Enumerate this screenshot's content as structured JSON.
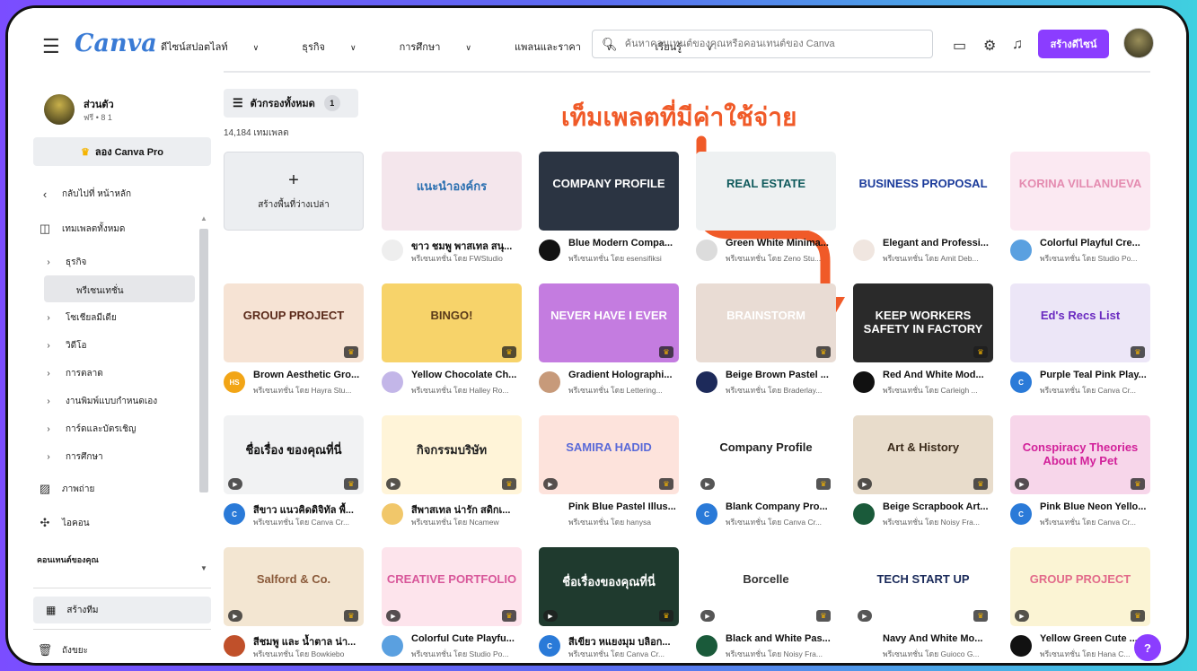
{
  "nav": {
    "logo": "Canva",
    "menu": [
      "ดีไซน์สปอตไลท์",
      "ธุรกิจ",
      "การศึกษา",
      "แพลนและราคา",
      "เรียนรู้"
    ],
    "search_placeholder": "ค้นหาคอนเทนต์ของคุณหรือคอนเทนต์ของ Canva",
    "create_label": "สร้างดีไซน์"
  },
  "sidebar": {
    "account_name": "ส่วนตัว",
    "account_sub": "ฟรี • 8 1",
    "try_pro": "ลอง Canva Pro",
    "back": "กลับไปที่ หน้าหลัก",
    "all_templates": "เทมเพลตทั้งหมด",
    "business": "ธุรกิจ",
    "presentation": "พรีเซนเทชั่น",
    "social": "โซเชียลมีเดีย",
    "video": "วิดีโอ",
    "marketing": "การตลาด",
    "custom_print": "งานพิมพ์แบบกำหนดเอง",
    "cards": "การ์ดและบัตรเชิญ",
    "education": "การศึกษา",
    "photos": "ภาพถ่าย",
    "icons": "ไอคอน",
    "your_content": "คอนเทนต์ของคุณ",
    "create_team": "สร้างทีม",
    "trash": "ถังขยะ"
  },
  "main": {
    "filter_label": "ตัวกรองทั้งหมด",
    "filter_count": "1",
    "template_count": "14,184 เทมเพลต",
    "headline": "เท็มเพลตที่มีค่าใช้จ่าย",
    "blank_label": "สร้างพื้นที่ว่างเปล่า"
  },
  "cards": [
    {
      "title": "ขาว ชมพู พาสเทล สนุ...",
      "by": "พรีเซนเทชั่น โดย FWStudio",
      "thumb_text": "แนะนำองค์กร",
      "bg": "#f4e6ec",
      "fg": "#2a6fb0",
      "avatar": "",
      "avatar_bg": "#eeeeee"
    },
    {
      "title": "Blue Modern Compa...",
      "by": "พรีเซนเทชั่น โดย esensifiksi",
      "thumb_text": "COMPANY PROFILE",
      "bg": "#2b3442",
      "fg": "#ffffff",
      "avatar": "",
      "avatar_bg": "#111111"
    },
    {
      "title": "Green White Minima...",
      "by": "พรีเซนเทชั่น โดย Zeno Stu...",
      "thumb_text": "REAL ESTATE",
      "bg": "#eef1f2",
      "fg": "#0f5a5c",
      "avatar": "",
      "avatar_bg": "#dcdcdc"
    },
    {
      "title": "Elegant and Professi...",
      "by": "พรีเซนเทชั่น โดย Amit Deb...",
      "thumb_text": "BUSINESS PROPOSAL",
      "bg": "#ffffff",
      "fg": "#1a3a9a",
      "avatar": "",
      "avatar_bg": "#f0e6e0"
    },
    {
      "title": "Colorful Playful Cre...",
      "by": "พรีเซนเทชั่น โดย Studio Po...",
      "thumb_text": "KORINA VILLANUEVA",
      "bg": "#fbe9f2",
      "fg": "#e48bb0",
      "avatar": "",
      "avatar_bg": "#5aa0e0"
    },
    {
      "title": "Brown Aesthetic Gro...",
      "by": "พรีเซนเทชั่น โดย Hayra Stu...",
      "thumb_text": "GROUP PROJECT",
      "bg": "#f6e3d4",
      "fg": "#5a2a1a",
      "avatar": "HS",
      "avatar_bg": "#f2a516"
    },
    {
      "title": "Yellow Chocolate Ch...",
      "by": "พรีเซนเทชั่น โดย Halley Ro...",
      "thumb_text": "BINGO!",
      "bg": "#f7d36a",
      "fg": "#5a3a1a",
      "avatar": "",
      "avatar_bg": "#c3b6e8"
    },
    {
      "title": "Gradient Holographi...",
      "by": "พรีเซนเทชั่น โดย Lettering...",
      "thumb_text": "NEVER HAVE I EVER",
      "bg": "#c47ce0",
      "fg": "#ffffff",
      "avatar": "",
      "avatar_bg": "#c79a7a"
    },
    {
      "title": "Beige Brown Pastel ...",
      "by": "พรีเซนเทชั่น โดย Braderlay...",
      "thumb_text": "BRAINSTORM",
      "bg": "#e9dcd4",
      "fg": "#ffffff",
      "avatar": "",
      "avatar_bg": "#1d2a5a"
    },
    {
      "title": "Red And White Mod...",
      "by": "พรีเซนเทชั่น โดย Carleigh ...",
      "thumb_text": "KEEP WORKERS SAFETY IN FACTORY",
      "bg": "#2a2a2a",
      "fg": "#ffffff",
      "avatar": "",
      "avatar_bg": "#111111"
    },
    {
      "title": "Purple Teal Pink Play...",
      "by": "พรีเซนเทชั่น โดย Canva Cr...",
      "thumb_text": "Ed's Recs List",
      "bg": "#ece6f7",
      "fg": "#6a2ac0",
      "avatar": "C",
      "avatar_bg": "#2a7ad8"
    },
    {
      "title": "สีขาว แนวคิดดิจิทัล พื้...",
      "by": "พรีเซนเทชั่น โดย Canva Cr...",
      "thumb_text": "ชื่อเรื่อง ของคุณที่นี่",
      "bg": "#f1f2f3",
      "fg": "#111111",
      "avatar": "C",
      "avatar_bg": "#2a7ad8"
    },
    {
      "title": "สีพาสเทล น่ารัก สดิกเ...",
      "by": "พรีเซนเทชั่น โดย Ncamew",
      "thumb_text": "กิจกรรมบริษัท",
      "bg": "#fff4d8",
      "fg": "#222222",
      "avatar": "",
      "avatar_bg": "#f1c76a"
    },
    {
      "title": "Pink Blue Pastel Illus...",
      "by": "พรีเซนเทชั่น โดย hanysa",
      "thumb_text": "SAMIRA HADID",
      "bg": "#fde3dc",
      "fg": "#5a6ad8",
      "avatar": "",
      "avatar_bg": "#ffffff"
    },
    {
      "title": "Blank Company Pro...",
      "by": "พรีเซนเทชั่น โดย Canva Cr...",
      "thumb_text": "Company Profile",
      "bg": "#ffffff",
      "fg": "#222222",
      "avatar": "C",
      "avatar_bg": "#2a7ad8"
    },
    {
      "title": "Beige Scrapbook Art...",
      "by": "พรีเซนเทชั่น โดย Noisy Fra...",
      "thumb_text": "Art & History",
      "bg": "#e8dccb",
      "fg": "#3a2a1a",
      "avatar": "",
      "avatar_bg": "#1a5a3a"
    },
    {
      "title": "Pink Blue Neon Yello...",
      "by": "พรีเซนเทชั่น โดย Canva Cr...",
      "thumb_text": "Conspiracy Theories About My Pet",
      "bg": "#f7d6ea",
      "fg": "#d2219a",
      "avatar": "C",
      "avatar_bg": "#2a7ad8"
    },
    {
      "title": "สีชมพู และ น้ำตาล น่า...",
      "by": "พรีเซนเทชั่น โดย Bowkiebo",
      "thumb_text": "Salford & Co.",
      "bg": "#f3e6d2",
      "fg": "#8a5a3a",
      "avatar": "",
      "avatar_bg": "#c0502a"
    },
    {
      "title": "Colorful Cute Playfu...",
      "by": "พรีเซนเทชั่น โดย Studio Po...",
      "thumb_text": "CREATIVE PORTFOLIO",
      "bg": "#fde4ec",
      "fg": "#d8579a",
      "avatar": "",
      "avatar_bg": "#5aa0e0"
    },
    {
      "title": "สีเขียว หแยงมุม บลิอก...",
      "by": "พรีเซนเทชั่น โดย Canva Cr...",
      "thumb_text": "ชื่อเรื่องของคุณที่นี่",
      "bg": "#1f3a2e",
      "fg": "#ffffff",
      "avatar": "C",
      "avatar_bg": "#2a7ad8"
    },
    {
      "title": "Black and White Pas...",
      "by": "พรีเซนเทชั่น โดย Noisy Fra...",
      "thumb_text": "Borcelle",
      "bg": "#ffffff",
      "fg": "#333333",
      "avatar": "",
      "avatar_bg": "#1a5a3a"
    },
    {
      "title": "Navy And White Mo...",
      "by": "พรีเซนเทชั่น โดย Guioco G...",
      "thumb_text": "TECH START UP",
      "bg": "#ffffff",
      "fg": "#1a2a5a",
      "avatar": "",
      "avatar_bg": "#ffffff"
    },
    {
      "title": "Yellow Green Cute ...",
      "by": "พรีเซนเทชั่น โดย Hana C...",
      "thumb_text": "GROUP PROJECT",
      "bg": "#fbf4d4",
      "fg": "#e26a8a",
      "avatar": "",
      "avatar_bg": "#111111"
    }
  ],
  "icons": {
    "menu": "menu-icon",
    "search": "search-icon",
    "monitor": "monitor-icon",
    "settings": "gear-icon",
    "bell": "bell-icon",
    "help": "?"
  }
}
